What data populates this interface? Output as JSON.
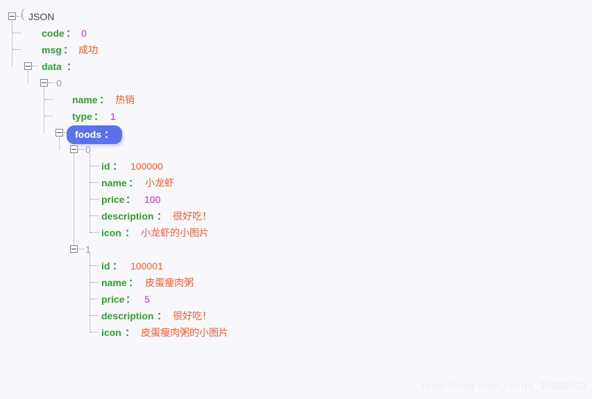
{
  "viewer": {
    "root_label": "JSON",
    "root_bracket": "(",
    "watermark": "https://blog.csdn.net/qq_37960603",
    "colors": {
      "background": "#f8f8fc",
      "key": "#2f9e2f",
      "string_value": "#f4592a",
      "number_value": "#cc22cc",
      "index": "#a0a0a0",
      "selected_pill": "#5a72ed",
      "selected_text": "#ffffff",
      "guide_line": "#9a9a9a"
    }
  },
  "nodes": {
    "code": {
      "key": "code",
      "colon": "：",
      "value": "0",
      "type": "number"
    },
    "msg": {
      "key": "msg",
      "colon": "：",
      "value": "成功",
      "type": "string"
    },
    "data": {
      "key": "data",
      "colon": "："
    },
    "data_0_index": {
      "label": "0"
    },
    "data_0_name": {
      "key": "name",
      "colon": "：",
      "value": "热销",
      "type": "string"
    },
    "data_0_type": {
      "key": "type",
      "colon": "：",
      "value": "1",
      "type": "number"
    },
    "foods": {
      "key": "foods ：",
      "selected": "true"
    },
    "food_0_index": {
      "label": "0"
    },
    "food_0_id": {
      "key": "id",
      "colon": "：",
      "value": "100000",
      "type": "string"
    },
    "food_0_name": {
      "key": "name",
      "colon": "：",
      "value": "小龙虾",
      "type": "string"
    },
    "food_0_price": {
      "key": "price",
      "colon": "：",
      "value": "100",
      "type": "number"
    },
    "food_0_description": {
      "key": "description",
      "colon": "：",
      "value": "很好吃！",
      "type": "string"
    },
    "food_0_icon": {
      "key": "icon",
      "colon": "：",
      "value": "小龙虾的小图片",
      "type": "string"
    },
    "food_1_index": {
      "label": "1"
    },
    "food_1_id": {
      "key": "id",
      "colon": "：",
      "value": "100001",
      "type": "string"
    },
    "food_1_name": {
      "key": "name",
      "colon": "：",
      "value": "皮蛋瘦肉粥",
      "type": "string"
    },
    "food_1_price": {
      "key": "price",
      "colon": "：",
      "value": "5",
      "type": "number"
    },
    "food_1_description": {
      "key": "description",
      "colon": "：",
      "value": "很好吃！",
      "type": "string"
    },
    "food_1_icon": {
      "key": "icon",
      "colon": "：",
      "value": "皮蛋瘦肉粥的小图片",
      "type": "string"
    }
  }
}
